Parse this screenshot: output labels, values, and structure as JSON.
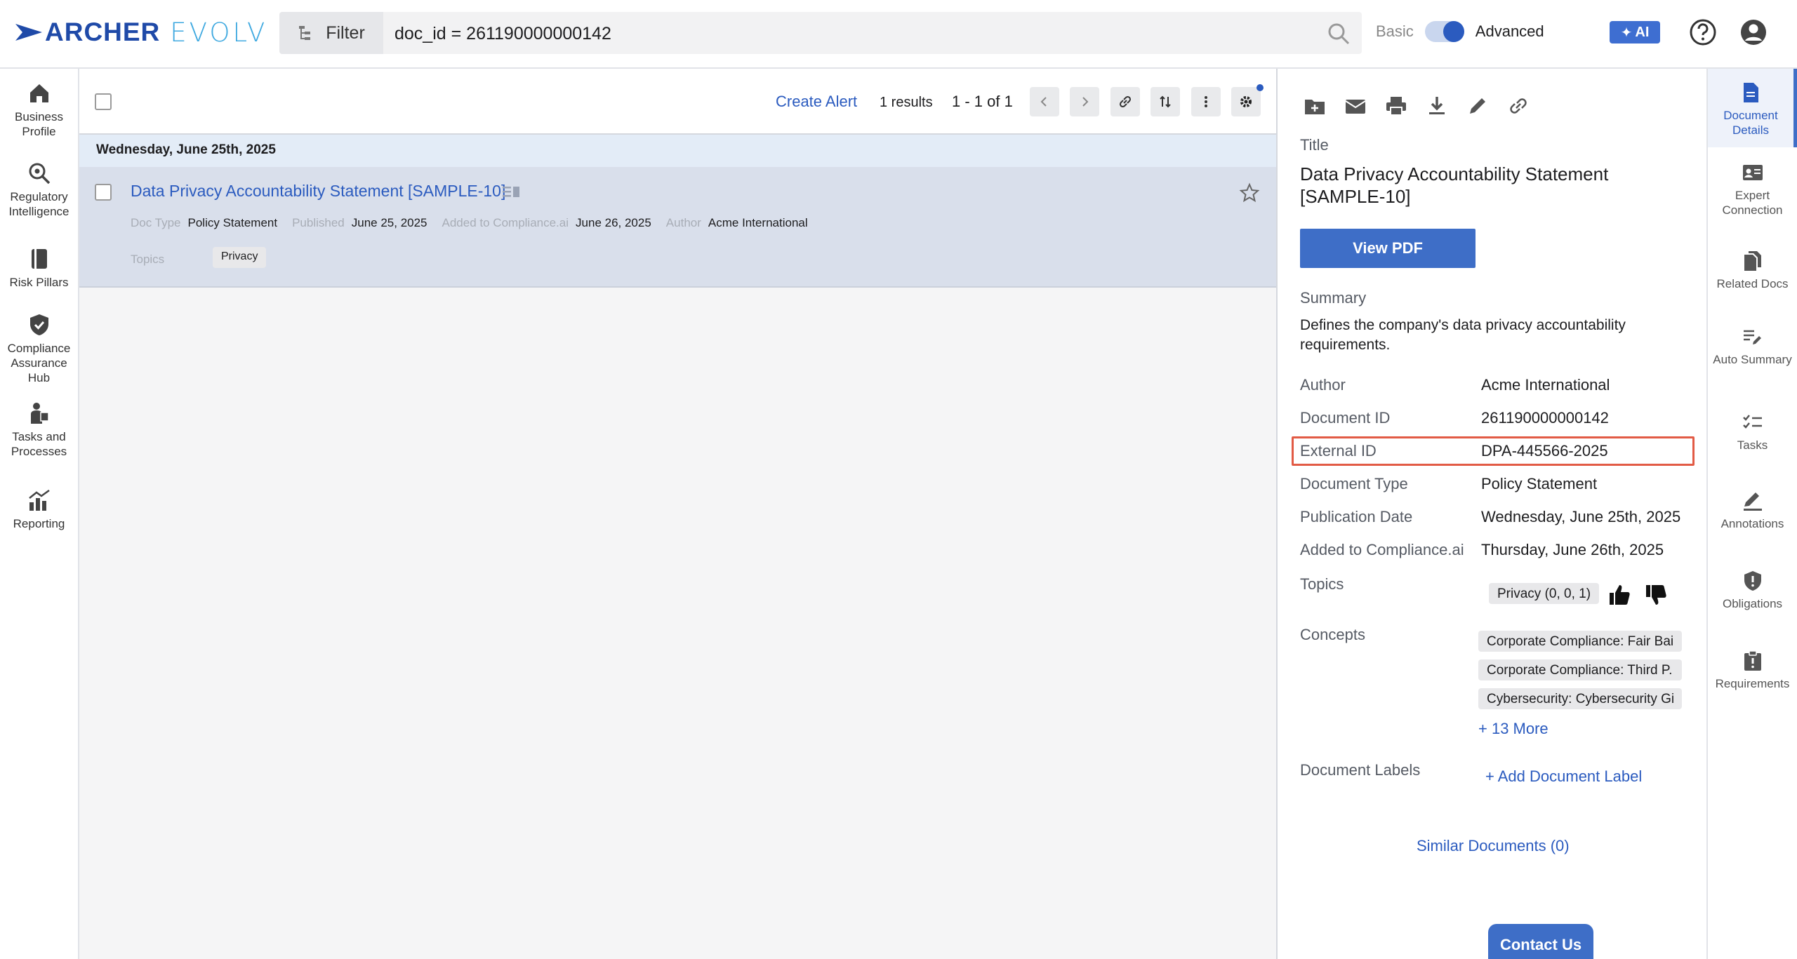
{
  "header": {
    "logo_word1": "ARCHER",
    "logo_word2": "EVOLV",
    "filter_label": "Filter",
    "search_value": "doc_id = 261190000000142",
    "mode_basic": "Basic",
    "mode_advanced": "Advanced",
    "ai_label": "AI"
  },
  "leftnav": [
    {
      "label": "Business Profile",
      "icon": "house-icon"
    },
    {
      "label": "Regulatory Intelligence",
      "icon": "magnify-icon"
    },
    {
      "label": "Risk Pillars",
      "icon": "book-icon"
    },
    {
      "label": "Compliance Assurance Hub",
      "icon": "shield-check-icon"
    },
    {
      "label": "Tasks and Processes",
      "icon": "person-task-icon"
    },
    {
      "label": "Reporting",
      "icon": "chart-icon"
    }
  ],
  "list": {
    "create_alert": "Create Alert",
    "results": "1 results",
    "pager": "1 - 1 of 1",
    "date_band": "Wednesday, June 25th, 2025",
    "item": {
      "title": "Data Privacy Accountability Statement [SAMPLE-10]",
      "doc_type_label": "Doc Type",
      "doc_type": "Policy Statement",
      "published_label": "Published",
      "published": "June 25, 2025",
      "added_label": "Added to Compliance.ai",
      "added": "June 26, 2025",
      "author_label": "Author",
      "author": "Acme International",
      "topics_label": "Topics",
      "topic": "Privacy"
    }
  },
  "detail": {
    "title_label": "Title",
    "title": "Data Privacy Accountability Statement [SAMPLE-10]",
    "view_pdf": "View PDF",
    "summary_label": "Summary",
    "summary": "Defines the company's data privacy accountability requirements.",
    "rows": [
      {
        "label": "Author",
        "value": "Acme International"
      },
      {
        "label": "Document ID",
        "value": "261190000000142"
      },
      {
        "label": "External ID",
        "value": "DPA-445566-2025"
      },
      {
        "label": "Document Type",
        "value": "Policy Statement"
      },
      {
        "label": "Publication Date",
        "value": "Wednesday, June 25th, 2025"
      },
      {
        "label": "Added to Compliance.ai",
        "value": "Thursday, June 26th, 2025"
      }
    ],
    "topics_label": "Topics",
    "topic_chip": "Privacy (0, 0, 1)",
    "concepts_label": "Concepts",
    "concepts": [
      "Corporate Compliance: Fair Bai",
      "Corporate Compliance: Third P.",
      "Cybersecurity: Cybersecurity Gi"
    ],
    "more_concepts": "+ 13 More",
    "labels_label": "Document Labels",
    "add_label": "+ Add Document Label",
    "similar": "Similar Documents (0)",
    "contact": "Contact Us"
  },
  "rail": [
    {
      "label": "Document Details",
      "icon": "document-icon"
    },
    {
      "label": "Expert Connection",
      "icon": "id-card-icon"
    },
    {
      "label": "Related Docs",
      "icon": "docs-icon"
    },
    {
      "label": "Auto Summary",
      "icon": "auto-summary-icon"
    },
    {
      "label": "Tasks",
      "icon": "checklist-icon"
    },
    {
      "label": "Annotations",
      "icon": "pencil-icon"
    },
    {
      "label": "Obligations",
      "icon": "shield-alert-icon"
    },
    {
      "label": "Requirements",
      "icon": "clipboard-alert-icon"
    }
  ]
}
